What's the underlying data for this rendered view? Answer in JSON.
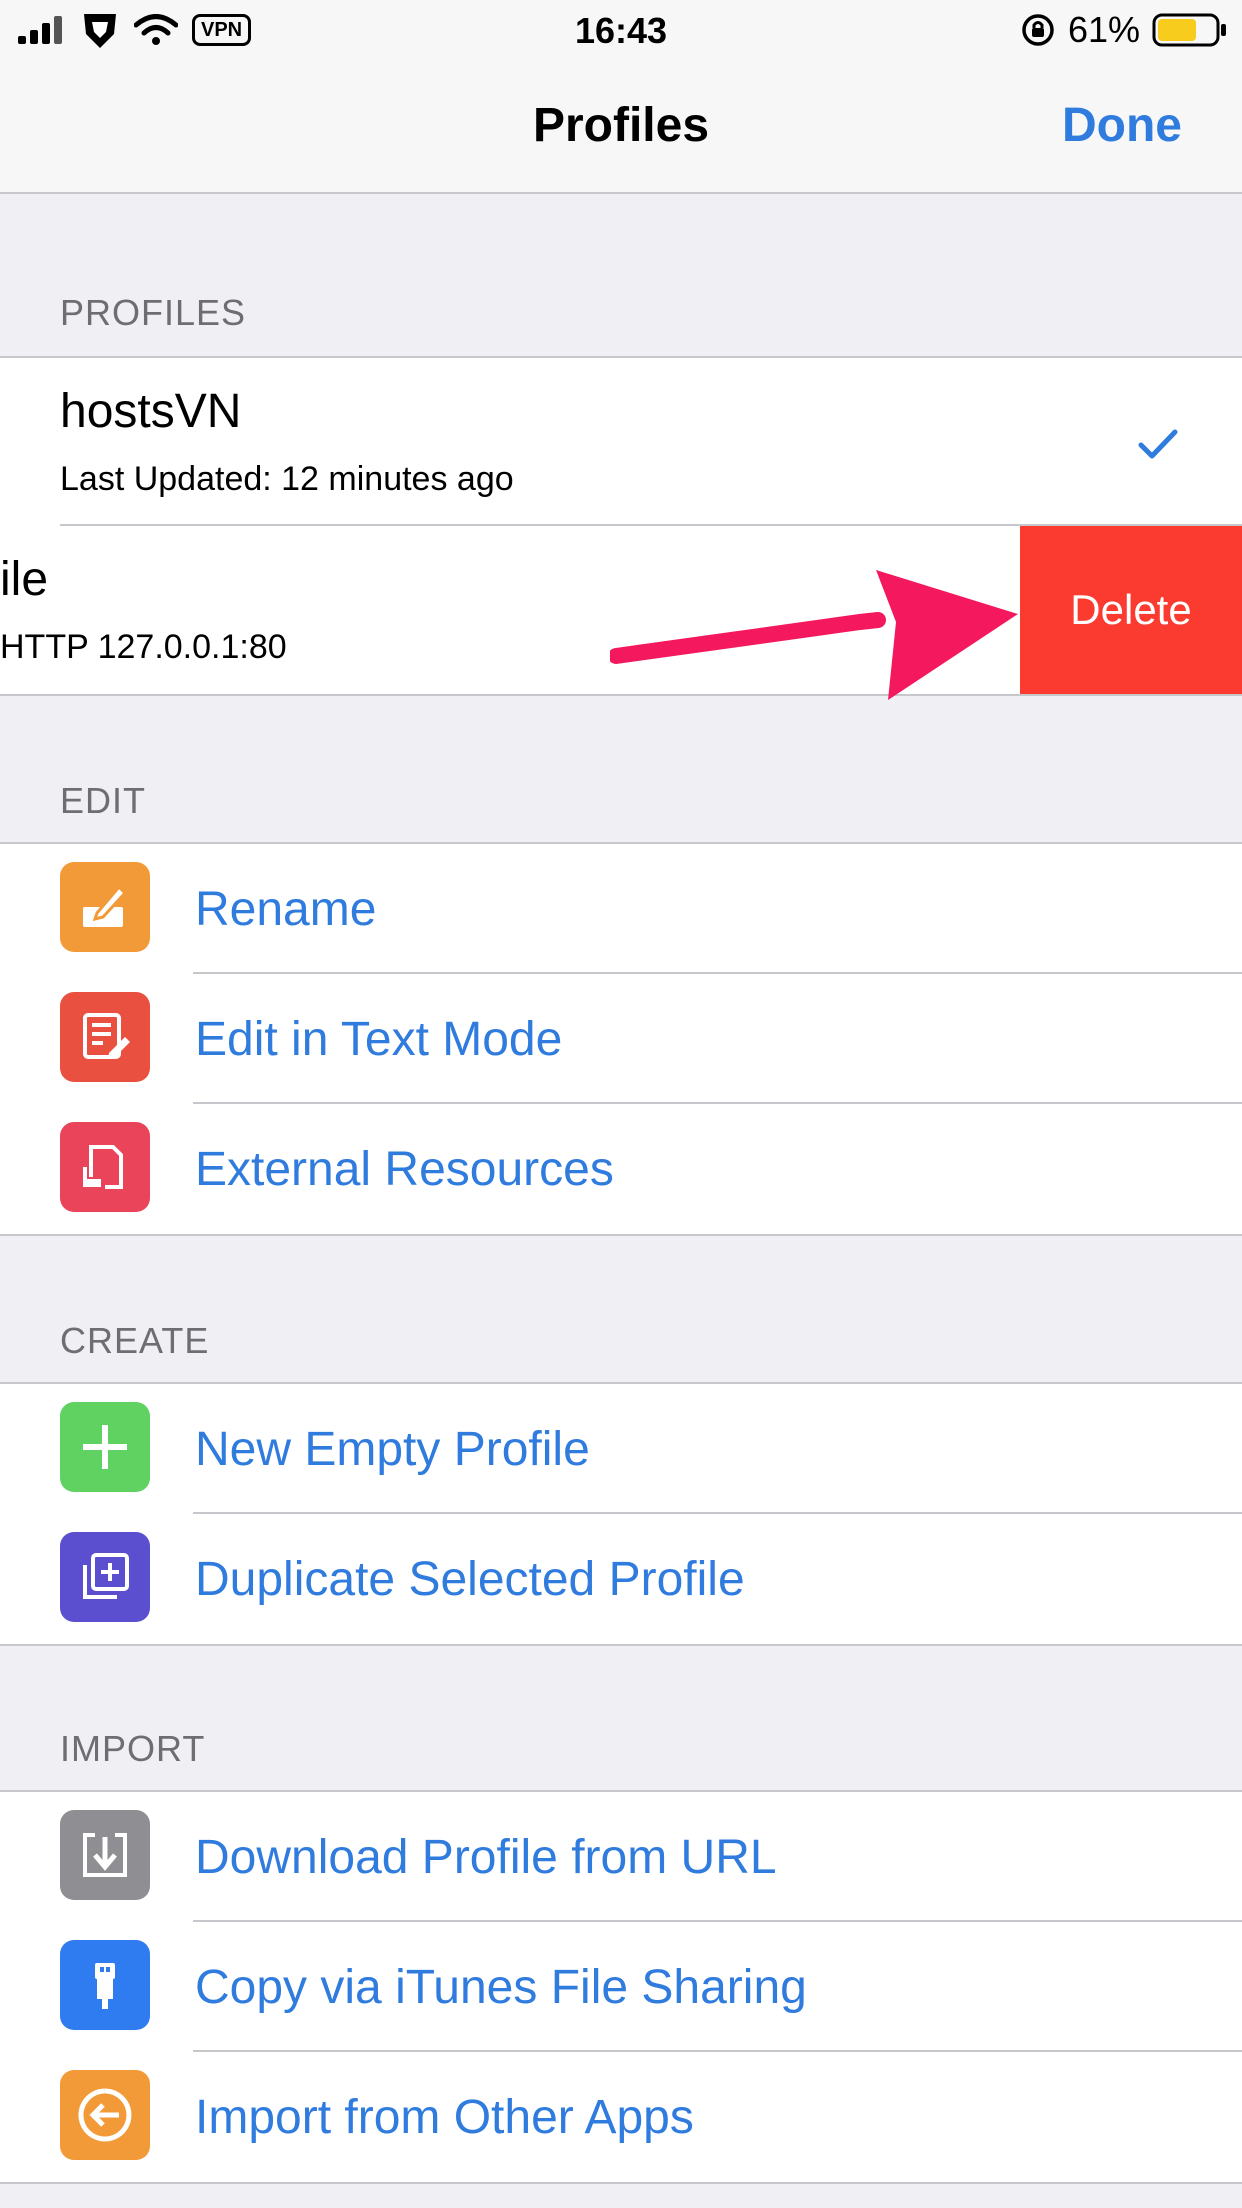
{
  "status_bar": {
    "time": "16:43",
    "vpn": "VPN",
    "battery": "61%"
  },
  "nav": {
    "title": "Profiles",
    "done_label": "Done"
  },
  "sections": {
    "profiles": {
      "header": "PROFILES",
      "items": [
        {
          "title": "hostsVN",
          "subtitle": "Last Updated: 12 minutes ago",
          "selected": true
        },
        {
          "title": "ile",
          "subtitle": "HTTP 127.0.0.1:80",
          "action": "Delete"
        }
      ]
    },
    "edit": {
      "header": "EDIT",
      "items": [
        {
          "label": "Rename",
          "icon": "pencil-icon",
          "color": "#f29a38"
        },
        {
          "label": "Edit in Text Mode",
          "icon": "document-edit-icon",
          "color": "#e9503f"
        },
        {
          "label": "External Resources",
          "icon": "external-resources-icon",
          "color": "#e94459"
        }
      ]
    },
    "create": {
      "header": "CREATE",
      "items": [
        {
          "label": "New Empty Profile",
          "icon": "plus-icon",
          "color": "#5fd262"
        },
        {
          "label": "Duplicate Selected Profile",
          "icon": "duplicate-icon",
          "color": "#5b4fcf"
        }
      ]
    },
    "import": {
      "header": "IMPORT",
      "items": [
        {
          "label": "Download Profile from URL",
          "icon": "download-icon",
          "color": "#8e8e93"
        },
        {
          "label": "Copy via iTunes File Sharing",
          "icon": "usb-icon",
          "color": "#2f7bf0"
        },
        {
          "label": "Import from Other Apps",
          "icon": "import-arrow-icon",
          "color": "#f29a38"
        }
      ]
    }
  },
  "colors": {
    "accent": "#2f7bde",
    "delete": "#fb3b30",
    "arrow": "#f4185e"
  }
}
